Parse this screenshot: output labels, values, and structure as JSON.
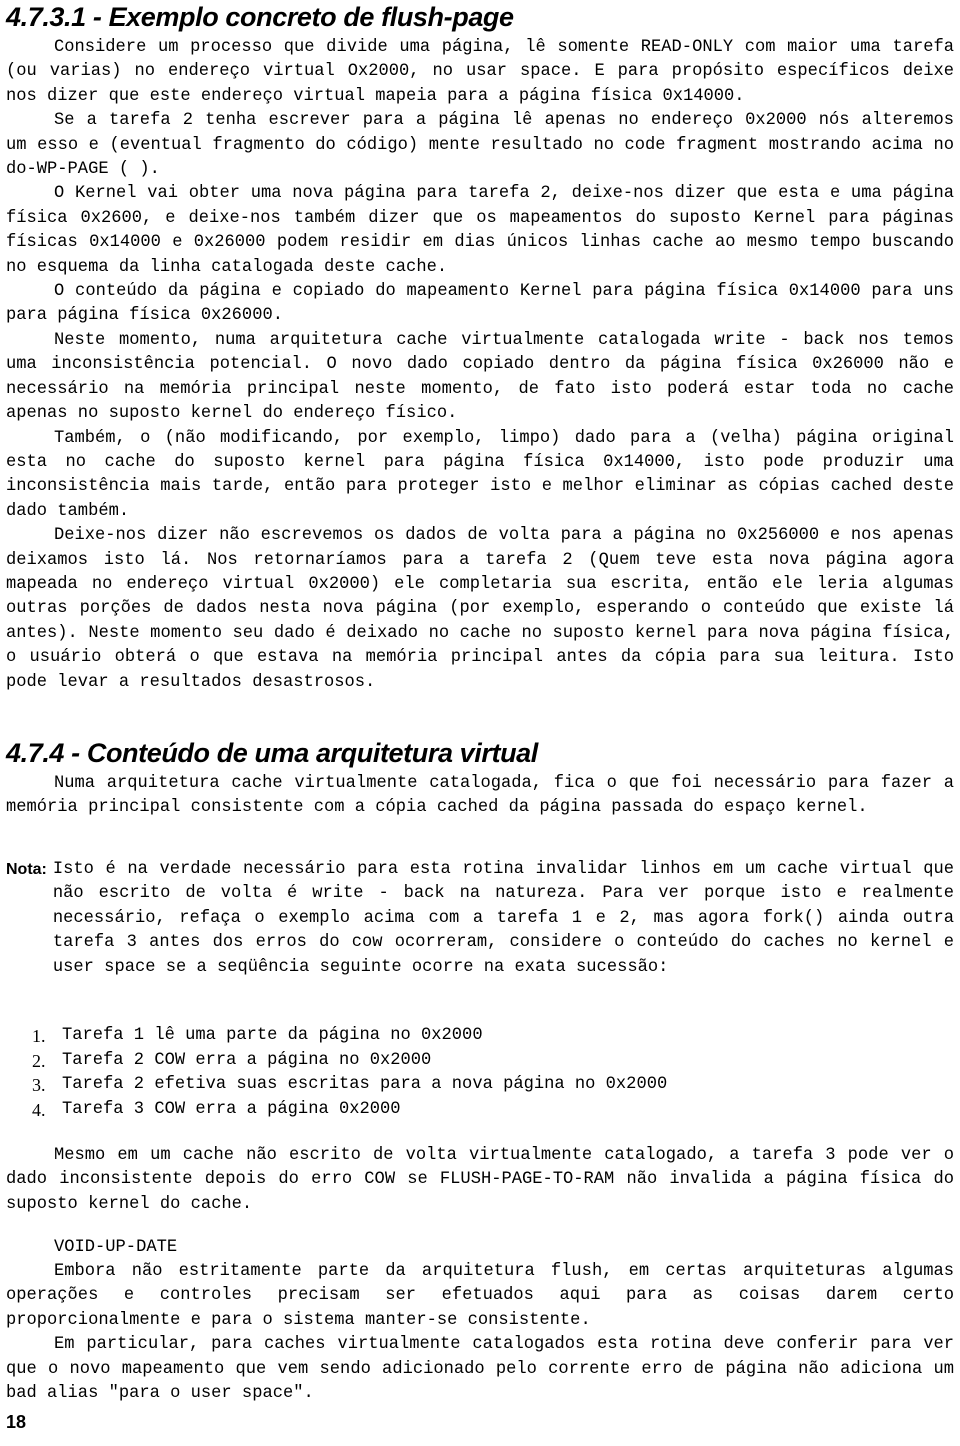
{
  "document": {
    "page_number": "18"
  },
  "headings": {
    "section_4731": "4.7.3.1 - Exemplo concreto de flush-page",
    "section_474": "4.7.4 - Conteúdo de uma arquitetura virtual"
  },
  "intro_paragraphs": [
    "Considere um processo que divide uma página, lê somente READ-ONLY com maior uma tarefa (ou varias) no endereço virtual Ox2000, no usar space. E para propósito específicos deixe nos dizer que este endereço virtual mapeia para a página física 0x14000.",
    "Se a tarefa 2 tenha escrever para a página lê apenas no endereço 0x2000 nós alteremos um esso e (eventual fragmento do código) mente resultado no code fragment mostrando acima no do-WP-PAGE ( ).",
    "O Kernel vai obter uma nova página para tarefa 2, deixe-nos dizer que esta e uma página física 0x2600, e deixe-nos também dizer que os mapeamentos do suposto Kernel para páginas físicas 0x14000 e 0x26000 podem residir em dias únicos linhas cache ao mesmo tempo buscando no esquema da linha catalogada deste cache.",
    "O conteúdo da página e copiado do mapeamento Kernel para página física 0x14000 para uns para página física 0x26000.",
    "Neste momento, numa arquitetura cache virtualmente catalogada write - back nos temos uma inconsistência potencial. O novo dado copiado dentro da página física 0x26000 não e necessário na memória principal neste momento, de fato isto poderá estar toda no cache apenas no suposto kernel do endereço físico.",
    "Também, o (não modificando, por exemplo, limpo) dado para a (velha) página original esta no cache do suposto kernel para página física 0x14000, isto pode produzir uma inconsistência mais tarde, então para proteger isto e melhor eliminar as cópias cached deste dado também.",
    "Deixe-nos dizer não escrevemos os dados de volta para a página no 0x256000 e nos apenas deixamos isto lá. Nos retornaríamos para a tarefa 2 (Quem teve esta nova página agora mapeada no endereço virtual 0x2000) ele completaria sua escrita, então ele leria algumas outras porções de dados nesta nova página (por exemplo, esperando o conteúdo que existe lá antes). Neste momento seu dado é deixado no cache no suposto kernel para nova página física, o usuário obterá o que estava na memória principal antes da cópia para sua leitura. Isto pode levar a resultados desastrosos."
  ],
  "section2_paragraphs": [
    "Numa arquitetura cache virtualmente catalogada, fica o que foi necessário para fazer a memória principal consistente com a cópia cached da página passada do espaço kernel."
  ],
  "nota": {
    "label": "Nota:",
    "text": "Isto é na verdade necessário para esta rotina invalidar linhos em um cache virtual que não escrito de volta é write - back na natureza. Para ver porque isto e realmente necessário, refaça o exemplo acima com a tarefa 1 e 2, mas agora fork() ainda outra tarefa 3 antes dos erros do cow ocorreram, considere o conteúdo do caches no kernel e user space se a seqüência seguinte ocorre na exata sucessão:"
  },
  "steps": [
    "Tarefa 1 lê uma parte da página no 0x2000",
    "Tarefa 2 COW erra a página no 0x2000",
    "Tarefa 2 efetiva suas escritas para a nova página no 0x2000",
    "Tarefa 3 COW erra a página 0x2000"
  ],
  "tail_paragraphs_1": [
    "Mesmo em um cache não escrito de volta virtualmente catalogado, a tarefa 3 pode ver o dado inconsistente depois do erro COW se FLUSH-PAGE-TO-RAM não invalida a página física do suposto kernel do cache."
  ],
  "void_label": "VOID-UP-DATE",
  "tail_paragraphs_2": [
    "Embora não estritamente parte da arquitetura flush, em certas arquiteturas algumas operações e controles precisam ser efetuados aqui para as coisas darem certo proporcionalmente e para o sistema manter-se consistente.",
    "Em particular, para caches virtualmente catalogados esta rotina deve conferir para ver que o novo mapeamento que vem sendo adicionado pelo corrente erro de página não adiciona um bad alias \"para o user space\"."
  ]
}
